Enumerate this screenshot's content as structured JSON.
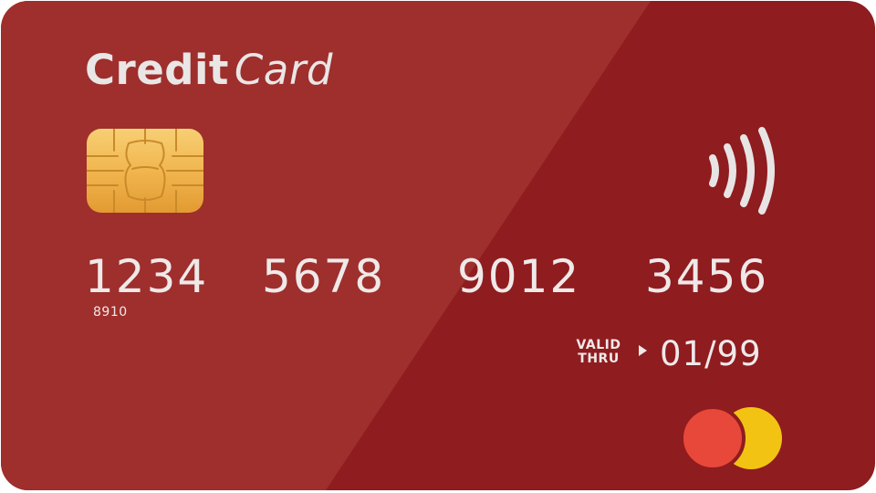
{
  "card": {
    "title_bold": "Credit",
    "title_italic": "Card",
    "number_groups": [
      "1234",
      "5678",
      "9012",
      "3456"
    ],
    "small_number": "8910",
    "valid_label_line1": "VALID",
    "valid_label_line2": "THRU",
    "expiry": "01/99"
  },
  "icons": {
    "chip": "emv-chip-icon",
    "contactless": "contactless-icon",
    "brand": "mastercard-logo"
  },
  "colors": {
    "card_background": "#8f1c1f",
    "sheen": "#9e2f2c",
    "text": "#efe9e9",
    "chip_gold": "#f1b64f",
    "logo_red": "#e8483a",
    "logo_yellow": "#f2c313"
  }
}
